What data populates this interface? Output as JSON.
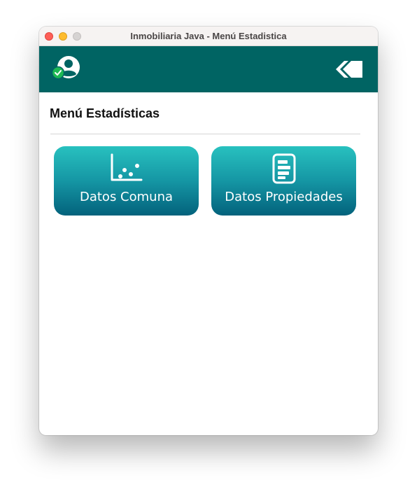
{
  "window": {
    "title": "Inmobiliaria Java - Menú Estadistica"
  },
  "appbar": {
    "background": "#006463",
    "user_icon": "user-verified-icon",
    "back_icon": "double-chevron-back-icon"
  },
  "main": {
    "heading": "Menú Estadísticas",
    "tiles": [
      {
        "label": "Datos Comuna",
        "icon": "scatter-chart-icon"
      },
      {
        "label": "Datos Propiedades",
        "icon": "bar-list-document-icon"
      }
    ]
  },
  "colors": {
    "tile_gradient_top": "#28c1bf",
    "tile_gradient_bottom": "#03627c",
    "status_green": "#1db954"
  }
}
